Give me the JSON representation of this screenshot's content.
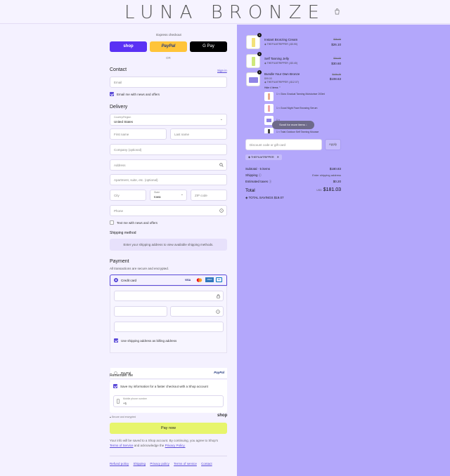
{
  "header": {
    "logo": "LUNA BRONZE"
  },
  "express": {
    "title": "Express checkout",
    "shop_label": "shop",
    "paypal_label": "PayPal",
    "gpay_label": "G Pay",
    "or_label": "OR"
  },
  "contact": {
    "heading": "Contact",
    "signin": "Sign in",
    "email_placeholder": "Email",
    "newsletter_label": "Email me with news and offers"
  },
  "delivery": {
    "heading": "Delivery",
    "country_label": "Country/Region",
    "country_value": "United States",
    "first_name": "First name",
    "last_name": "Last name",
    "company": "Company (optional)",
    "address": "Address",
    "apartment": "Apartment, suite, etc. (optional)",
    "city": "City",
    "state_label": "State",
    "state_value": "Iowa",
    "zip": "ZIP code",
    "phone": "Phone",
    "sms_label": "Text me with news and offers"
  },
  "shipping": {
    "heading": "Shipping method",
    "message": "Enter your shipping address to view available shipping methods."
  },
  "payment": {
    "heading": "Payment",
    "subtitle": "All transactions are secure and encrypted.",
    "credit_card_label": "Credit card",
    "billing_label": "Use shipping address as billing address",
    "paypal_label": "PayPal",
    "afterpay_label": "Afterpay",
    "card_brands": [
      "VISA",
      "MC",
      "AMEX",
      "DC"
    ]
  },
  "remember": {
    "heading": "Remember me",
    "save_label": "Save my information for a faster checkout with a Shop account",
    "mobile_label": "Mobile phone number",
    "mobile_value": "+1",
    "secure_label": "Secure and encrypted",
    "shop_label": "shop"
  },
  "pay_now": "Pay now",
  "legal": {
    "line1": "Your info will be saved to a Shop account. By continuing, you agree to Shop's",
    "terms": "Terms of Service",
    "and_text": "and acknowledge the",
    "privacy": "Privacy Policy."
  },
  "footer_links": [
    "Refund policy",
    "Shipping",
    "Privacy policy",
    "Terms of service",
    "Contact"
  ],
  "cart": {
    "items": [
      {
        "name": "Instant Bronzing Cream",
        "discount": "THEFILMTRIPPER (-$3.90)",
        "original": "$29.00",
        "price": "$26.10",
        "qty": "1"
      },
      {
        "name": "Self Tanning Jelly",
        "discount": "THEFILMTRIPPER (-$3.40)",
        "original": "$34.00",
        "price": "$30.60",
        "qty": "1"
      },
      {
        "name": "Bundle Your Own Bronze",
        "sub": "$99.00",
        "discount": "THEFILMTRIPPER (-$12.07)",
        "original": "$120.70",
        "price": "$108.63",
        "qty": "1",
        "hide_label": "Hide 4 items"
      }
    ],
    "bundle_items": [
      "1 × Glow Gradual Tanning Moisturiser 200ml",
      "1 × Good Night Face Bronzing Serum",
      "1 ×",
      "1 × Total Outdoor Self Tanning Mousse"
    ],
    "scroll_label": "Scroll for more items",
    "discount_placeholder": "Discount code or gift card",
    "apply_label": "Apply",
    "code_tag": "THEFILMTRIPPER",
    "subtotal_label": "Subtotal · 5 items",
    "subtotal_value": "$180.83",
    "shipping_label": "Shipping",
    "shipping_value": "Enter shipping address",
    "taxes_label": "Estimated taxes",
    "taxes_value": "$0.20",
    "total_label": "Total",
    "currency": "USD",
    "total_value": "$181.03",
    "savings_label": "TOTAL SAVINGS",
    "savings_value": "$19.07"
  }
}
